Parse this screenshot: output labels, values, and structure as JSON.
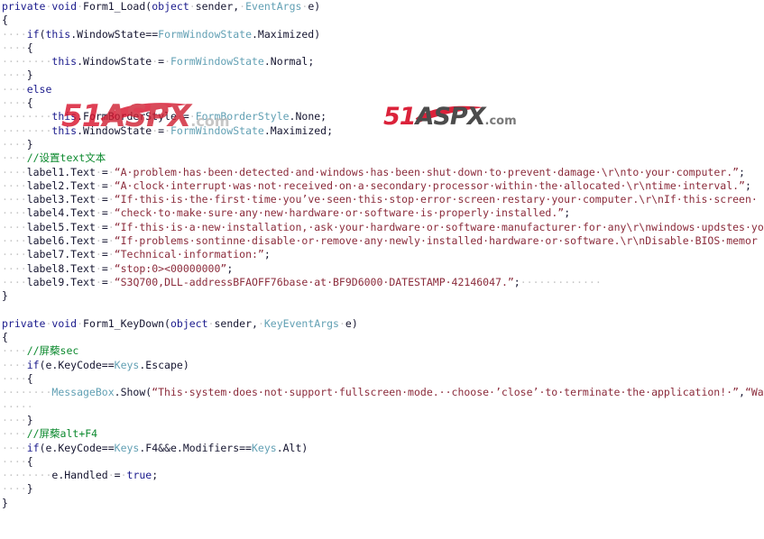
{
  "editor": {
    "kind": "code-editor",
    "language": "csharp",
    "background": "#ffffff",
    "colors": {
      "keyword": "#1a1a8c",
      "type": "#62a0b4",
      "string": "#8b2b3b",
      "comment": "#0d8a2f",
      "plain": "#151530",
      "whitespace_dot": "#c8c8c8"
    },
    "lines": [
      {
        "n": 1,
        "indent": 0,
        "tokens": [
          {
            "t": "kw",
            "v": "private"
          },
          {
            "t": "ws",
            "v": "·"
          },
          {
            "t": "kw",
            "v": "void"
          },
          {
            "t": "ws",
            "v": "·"
          },
          {
            "t": "pln",
            "v": "Form1_Load("
          },
          {
            "t": "kw",
            "v": "object"
          },
          {
            "t": "ws",
            "v": "·"
          },
          {
            "t": "pln",
            "v": "sender,"
          },
          {
            "t": "ws",
            "v": "·"
          },
          {
            "t": "typ",
            "v": "EventArgs"
          },
          {
            "t": "ws",
            "v": "·"
          },
          {
            "t": "pln",
            "v": "e)"
          }
        ]
      },
      {
        "n": 2,
        "indent": 0,
        "tokens": [
          {
            "t": "pln",
            "v": "{"
          }
        ]
      },
      {
        "n": 3,
        "indent": 1,
        "tokens": [
          {
            "t": "ws",
            "v": "····"
          },
          {
            "t": "kw",
            "v": "if"
          },
          {
            "t": "pln",
            "v": "("
          },
          {
            "t": "kw",
            "v": "this"
          },
          {
            "t": "pln",
            "v": ".WindowState=="
          },
          {
            "t": "typ",
            "v": "FormWindowState"
          },
          {
            "t": "pln",
            "v": ".Maximized)"
          }
        ]
      },
      {
        "n": 4,
        "indent": 1,
        "tokens": [
          {
            "t": "ws",
            "v": "····"
          },
          {
            "t": "pln",
            "v": "{"
          }
        ]
      },
      {
        "n": 5,
        "indent": 2,
        "tokens": [
          {
            "t": "ws",
            "v": "········"
          },
          {
            "t": "kw",
            "v": "this"
          },
          {
            "t": "pln",
            "v": ".WindowState"
          },
          {
            "t": "ws",
            "v": "·"
          },
          {
            "t": "pln",
            "v": "="
          },
          {
            "t": "ws",
            "v": "·"
          },
          {
            "t": "typ",
            "v": "FormWindowState"
          },
          {
            "t": "pln",
            "v": ".Normal;"
          }
        ]
      },
      {
        "n": 6,
        "indent": 1,
        "tokens": [
          {
            "t": "ws",
            "v": "····"
          },
          {
            "t": "pln",
            "v": "}"
          }
        ]
      },
      {
        "n": 7,
        "indent": 1,
        "tokens": [
          {
            "t": "ws",
            "v": "····"
          },
          {
            "t": "kw",
            "v": "else"
          }
        ]
      },
      {
        "n": 8,
        "indent": 1,
        "tokens": [
          {
            "t": "ws",
            "v": "····"
          },
          {
            "t": "pln",
            "v": "{"
          }
        ]
      },
      {
        "n": 9,
        "indent": 2,
        "tokens": [
          {
            "t": "ws",
            "v": "········"
          },
          {
            "t": "kw",
            "v": "this"
          },
          {
            "t": "pln",
            "v": ".FormBorderStyle"
          },
          {
            "t": "ws",
            "v": "·"
          },
          {
            "t": "pln",
            "v": "="
          },
          {
            "t": "ws",
            "v": "·"
          },
          {
            "t": "typ",
            "v": "FormBorderStyle"
          },
          {
            "t": "pln",
            "v": ".None;"
          }
        ]
      },
      {
        "n": 10,
        "indent": 2,
        "tokens": [
          {
            "t": "ws",
            "v": "········"
          },
          {
            "t": "kw",
            "v": "this"
          },
          {
            "t": "pln",
            "v": ".WindowState"
          },
          {
            "t": "ws",
            "v": "·"
          },
          {
            "t": "pln",
            "v": "="
          },
          {
            "t": "ws",
            "v": "·"
          },
          {
            "t": "typ",
            "v": "FormWindowState"
          },
          {
            "t": "pln",
            "v": ".Maximized;"
          }
        ]
      },
      {
        "n": 11,
        "indent": 1,
        "tokens": [
          {
            "t": "ws",
            "v": "····"
          },
          {
            "t": "pln",
            "v": "}"
          }
        ]
      },
      {
        "n": 12,
        "indent": 1,
        "tokens": [
          {
            "t": "ws",
            "v": "····"
          },
          {
            "t": "cmt",
            "v": "//设置text文本"
          }
        ]
      },
      {
        "n": 13,
        "indent": 1,
        "tokens": [
          {
            "t": "ws",
            "v": "····"
          },
          {
            "t": "pln",
            "v": "label1.Text"
          },
          {
            "t": "ws",
            "v": "·"
          },
          {
            "t": "pln",
            "v": "="
          },
          {
            "t": "ws",
            "v": "·"
          },
          {
            "t": "str",
            "v": "“A·problem·has·been·detected·and·windows·has·been·shut·down·to·prevent·damage·\\r\\nto·your·computer.”"
          },
          {
            "t": "pln",
            "v": ";"
          }
        ]
      },
      {
        "n": 14,
        "indent": 1,
        "tokens": [
          {
            "t": "ws",
            "v": "····"
          },
          {
            "t": "pln",
            "v": "label2.Text"
          },
          {
            "t": "ws",
            "v": "·"
          },
          {
            "t": "pln",
            "v": "="
          },
          {
            "t": "ws",
            "v": "·"
          },
          {
            "t": "str",
            "v": "“A·clock·interrupt·was·not·received·on·a·secondary·processor·within·the·allocated·\\r\\ntime·interval.”"
          },
          {
            "t": "pln",
            "v": ";"
          }
        ]
      },
      {
        "n": 15,
        "indent": 1,
        "tokens": [
          {
            "t": "ws",
            "v": "····"
          },
          {
            "t": "pln",
            "v": "label3.Text"
          },
          {
            "t": "ws",
            "v": "·"
          },
          {
            "t": "pln",
            "v": "="
          },
          {
            "t": "ws",
            "v": "·"
          },
          {
            "t": "str",
            "v": "“If·this·is·the·first·time·you’ve·seen·this·stop·error·screen·restary·your·computer.\\r\\nIf·this·screen·"
          }
        ]
      },
      {
        "n": 16,
        "indent": 1,
        "tokens": [
          {
            "t": "ws",
            "v": "····"
          },
          {
            "t": "pln",
            "v": "label4.Text"
          },
          {
            "t": "ws",
            "v": "·"
          },
          {
            "t": "pln",
            "v": "="
          },
          {
            "t": "ws",
            "v": "·"
          },
          {
            "t": "str",
            "v": "“check·to·make·sure·any·new·hardware·or·software·is·properly·installed.”"
          },
          {
            "t": "pln",
            "v": ";"
          }
        ]
      },
      {
        "n": 17,
        "indent": 1,
        "tokens": [
          {
            "t": "ws",
            "v": "····"
          },
          {
            "t": "pln",
            "v": "label5.Text"
          },
          {
            "t": "ws",
            "v": "·"
          },
          {
            "t": "pln",
            "v": "="
          },
          {
            "t": "ws",
            "v": "·"
          },
          {
            "t": "str",
            "v": "“If·this·is·a·new·installation,·ask·your·hardware·or·software·manufacturer·for·any\\r\\nwindows·updstes·yo"
          }
        ]
      },
      {
        "n": 18,
        "indent": 1,
        "tokens": [
          {
            "t": "ws",
            "v": "····"
          },
          {
            "t": "pln",
            "v": "label6.Text"
          },
          {
            "t": "ws",
            "v": "·"
          },
          {
            "t": "pln",
            "v": "="
          },
          {
            "t": "ws",
            "v": "·"
          },
          {
            "t": "str",
            "v": "“If·problems·sontinne·disable·or·remove·any·newly·installed·hardware·or·software.\\r\\nDisable·BIOS·memor"
          }
        ]
      },
      {
        "n": 19,
        "indent": 1,
        "tokens": [
          {
            "t": "ws",
            "v": "····"
          },
          {
            "t": "pln",
            "v": "label7.Text"
          },
          {
            "t": "ws",
            "v": "·"
          },
          {
            "t": "pln",
            "v": "="
          },
          {
            "t": "ws",
            "v": "·"
          },
          {
            "t": "str",
            "v": "“Technical·information:”"
          },
          {
            "t": "pln",
            "v": ";"
          }
        ]
      },
      {
        "n": 20,
        "indent": 1,
        "tokens": [
          {
            "t": "ws",
            "v": "····"
          },
          {
            "t": "pln",
            "v": "label8.Text"
          },
          {
            "t": "ws",
            "v": "·"
          },
          {
            "t": "pln",
            "v": "="
          },
          {
            "t": "ws",
            "v": "·"
          },
          {
            "t": "str",
            "v": "“stop:0><00000000”"
          },
          {
            "t": "pln",
            "v": ";"
          }
        ]
      },
      {
        "n": 21,
        "indent": 1,
        "tokens": [
          {
            "t": "ws",
            "v": "····"
          },
          {
            "t": "pln",
            "v": "label9.Text"
          },
          {
            "t": "ws",
            "v": "·"
          },
          {
            "t": "pln",
            "v": "="
          },
          {
            "t": "ws",
            "v": "·"
          },
          {
            "t": "str",
            "v": "“S3Q700,DLL-addressBFAOFF76base·at·BF9D6000·DATESTAMP·42146047.”"
          },
          {
            "t": "pln",
            "v": ";"
          },
          {
            "t": "ws",
            "v": "·············"
          }
        ]
      },
      {
        "n": 22,
        "indent": 0,
        "tokens": [
          {
            "t": "pln",
            "v": "}"
          }
        ]
      },
      {
        "n": 23,
        "indent": 0,
        "tokens": []
      },
      {
        "n": 24,
        "indent": 0,
        "tokens": [
          {
            "t": "kw",
            "v": "private"
          },
          {
            "t": "ws",
            "v": "·"
          },
          {
            "t": "kw",
            "v": "void"
          },
          {
            "t": "ws",
            "v": "·"
          },
          {
            "t": "pln",
            "v": "Form1_KeyDown("
          },
          {
            "t": "kw",
            "v": "object"
          },
          {
            "t": "ws",
            "v": "·"
          },
          {
            "t": "pln",
            "v": "sender,"
          },
          {
            "t": "ws",
            "v": "·"
          },
          {
            "t": "typ",
            "v": "KeyEventArgs"
          },
          {
            "t": "ws",
            "v": "·"
          },
          {
            "t": "pln",
            "v": "e)"
          }
        ]
      },
      {
        "n": 25,
        "indent": 0,
        "tokens": [
          {
            "t": "pln",
            "v": "{"
          }
        ]
      },
      {
        "n": 26,
        "indent": 1,
        "tokens": [
          {
            "t": "ws",
            "v": "····"
          },
          {
            "t": "cmt",
            "v": "//屏蔾sec"
          }
        ]
      },
      {
        "n": 27,
        "indent": 1,
        "tokens": [
          {
            "t": "ws",
            "v": "····"
          },
          {
            "t": "kw",
            "v": "if"
          },
          {
            "t": "pln",
            "v": "(e.KeyCode=="
          },
          {
            "t": "typ",
            "v": "Keys"
          },
          {
            "t": "pln",
            "v": ".Escape)"
          }
        ]
      },
      {
        "n": 28,
        "indent": 1,
        "tokens": [
          {
            "t": "ws",
            "v": "····"
          },
          {
            "t": "pln",
            "v": "{"
          }
        ]
      },
      {
        "n": 29,
        "indent": 2,
        "tokens": [
          {
            "t": "ws",
            "v": "········"
          },
          {
            "t": "typ",
            "v": "MessageBox"
          },
          {
            "t": "pln",
            "v": ".Show("
          },
          {
            "t": "str",
            "v": "“This·system·does·not·support·fullscreen·mode.··choose·’close’·to·terminate·the·application!·”"
          },
          {
            "t": "pln",
            "v": ","
          },
          {
            "t": "str",
            "v": "“Wa"
          }
        ]
      },
      {
        "n": 30,
        "indent": 1,
        "tokens": [
          {
            "t": "ws",
            "v": "·····"
          }
        ]
      },
      {
        "n": 31,
        "indent": 1,
        "tokens": [
          {
            "t": "ws",
            "v": "····"
          },
          {
            "t": "pln",
            "v": "}"
          }
        ]
      },
      {
        "n": 32,
        "indent": 1,
        "tokens": [
          {
            "t": "ws",
            "v": "····"
          },
          {
            "t": "cmt",
            "v": "//屏蔾alt+F4"
          }
        ]
      },
      {
        "n": 33,
        "indent": 1,
        "tokens": [
          {
            "t": "ws",
            "v": "····"
          },
          {
            "t": "kw",
            "v": "if"
          },
          {
            "t": "pln",
            "v": "(e.KeyCode=="
          },
          {
            "t": "typ",
            "v": "Keys"
          },
          {
            "t": "pln",
            "v": ".F4&&e.Modifiers=="
          },
          {
            "t": "typ",
            "v": "Keys"
          },
          {
            "t": "pln",
            "v": ".Alt)"
          }
        ]
      },
      {
        "n": 34,
        "indent": 1,
        "tokens": [
          {
            "t": "ws",
            "v": "····"
          },
          {
            "t": "pln",
            "v": "{"
          }
        ]
      },
      {
        "n": 35,
        "indent": 2,
        "tokens": [
          {
            "t": "ws",
            "v": "········"
          },
          {
            "t": "pln",
            "v": "e.Handled"
          },
          {
            "t": "ws",
            "v": "·"
          },
          {
            "t": "pln",
            "v": "="
          },
          {
            "t": "ws",
            "v": "·"
          },
          {
            "t": "kw",
            "v": "true"
          },
          {
            "t": "pln",
            "v": ";"
          }
        ]
      },
      {
        "n": 36,
        "indent": 1,
        "tokens": [
          {
            "t": "ws",
            "v": "····"
          },
          {
            "t": "pln",
            "v": "}"
          }
        ]
      },
      {
        "n": 37,
        "indent": 0,
        "tokens": [
          {
            "t": "pln",
            "v": "}"
          }
        ]
      }
    ]
  },
  "watermarks": [
    {
      "id": "watermark-left",
      "number": "51",
      "word": "ASPX",
      "domain": ".com",
      "style": "red",
      "number_color": "#d8102a",
      "word_color": "#cf1f32",
      "domain_color": "#b8b8b8"
    },
    {
      "id": "watermark-right",
      "number": "51",
      "word": "ASPX",
      "domain": ".com",
      "style": "gray",
      "number_color": "#d8102a",
      "word_color": "#3d3d3d",
      "domain_color": "#6e6e6e"
    }
  ]
}
